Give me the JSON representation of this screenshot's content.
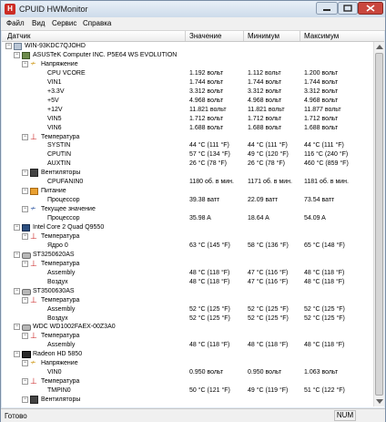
{
  "window": {
    "title": "CPUID HWMonitor",
    "app_icon_letter": "H"
  },
  "menu": {
    "items": [
      "Файл",
      "Вид",
      "Сервис",
      "Справка"
    ]
  },
  "columns": {
    "sensor": "Датчик",
    "value": "Значение",
    "min": "Минимум",
    "max": "Максимум"
  },
  "tree": [
    {
      "indent": 0,
      "expander": "-",
      "icon": "pc",
      "label": "WIN-93KDC7QJOHD",
      "v": "",
      "mn": "",
      "mx": ""
    },
    {
      "indent": 1,
      "expander": "-",
      "icon": "board",
      "label": "ASUSTeK Computer INC. P5E64 WS EVOLUTION",
      "v": "",
      "mn": "",
      "mx": ""
    },
    {
      "indent": 2,
      "expander": "-",
      "icon": "volt",
      "label": "Напряжение",
      "v": "",
      "mn": "",
      "mx": ""
    },
    {
      "indent": 4,
      "expander": "",
      "icon": "",
      "label": "CPU VCORE",
      "v": "1.192 вольт",
      "mn": "1.112 вольт",
      "mx": "1.200 вольт"
    },
    {
      "indent": 4,
      "expander": "",
      "icon": "",
      "label": "VIN1",
      "v": "1.744 вольт",
      "mn": "1.744 вольт",
      "mx": "1.744 вольт"
    },
    {
      "indent": 4,
      "expander": "",
      "icon": "",
      "label": "+3.3V",
      "v": "3.312 вольт",
      "mn": "3.312 вольт",
      "mx": "3.312 вольт"
    },
    {
      "indent": 4,
      "expander": "",
      "icon": "",
      "label": "+5V",
      "v": "4.968 вольт",
      "mn": "4.968 вольт",
      "mx": "4.968 вольт"
    },
    {
      "indent": 4,
      "expander": "",
      "icon": "",
      "label": "+12V",
      "v": "11.821 вольт",
      "mn": "11.821 вольт",
      "mx": "11.877 вольт"
    },
    {
      "indent": 4,
      "expander": "",
      "icon": "",
      "label": "VIN5",
      "v": "1.712 вольт",
      "mn": "1.712 вольт",
      "mx": "1.712 вольт"
    },
    {
      "indent": 4,
      "expander": "",
      "icon": "",
      "label": "VIN6",
      "v": "1.688 вольт",
      "mn": "1.688 вольт",
      "mx": "1.688 вольт"
    },
    {
      "indent": 2,
      "expander": "-",
      "icon": "therm",
      "label": "Температура",
      "v": "",
      "mn": "",
      "mx": ""
    },
    {
      "indent": 4,
      "expander": "",
      "icon": "",
      "label": "SYSTIN",
      "v": "44 °C (111 °F)",
      "mn": "44 °C (111 °F)",
      "mx": "44 °C (111 °F)"
    },
    {
      "indent": 4,
      "expander": "",
      "icon": "",
      "label": "CPUTIN",
      "v": "57 °C (134 °F)",
      "mn": "49 °C (120 °F)",
      "mx": "116 °C (240 °F)"
    },
    {
      "indent": 4,
      "expander": "",
      "icon": "",
      "label": "AUXTIN",
      "v": "26 °C (78 °F)",
      "mn": "26 °C (78 °F)",
      "mx": "460 °C (859 °F)"
    },
    {
      "indent": 2,
      "expander": "-",
      "icon": "fan",
      "label": "Вентиляторы",
      "v": "",
      "mn": "",
      "mx": ""
    },
    {
      "indent": 4,
      "expander": "",
      "icon": "",
      "label": "CPUFANIN0",
      "v": "1180 об. в мин.",
      "mn": "1171 об. в мин.",
      "mx": "1181 об. в мин."
    },
    {
      "indent": 2,
      "expander": "-",
      "icon": "power",
      "label": "Питание",
      "v": "",
      "mn": "",
      "mx": ""
    },
    {
      "indent": 4,
      "expander": "",
      "icon": "",
      "label": "Процессор",
      "v": "39.38 ватт",
      "mn": "22.09 ватт",
      "mx": "73.54 ватт"
    },
    {
      "indent": 2,
      "expander": "-",
      "icon": "curr",
      "label": "Текущее значение",
      "v": "",
      "mn": "",
      "mx": ""
    },
    {
      "indent": 4,
      "expander": "",
      "icon": "",
      "label": "Процессор",
      "v": "35.98 A",
      "mn": "18.64 A",
      "mx": "54.09 A"
    },
    {
      "indent": 1,
      "expander": "-",
      "icon": "cpu",
      "label": "Intel Core 2 Quad Q9550",
      "v": "",
      "mn": "",
      "mx": ""
    },
    {
      "indent": 2,
      "expander": "-",
      "icon": "therm",
      "label": "Температура",
      "v": "",
      "mn": "",
      "mx": ""
    },
    {
      "indent": 4,
      "expander": "",
      "icon": "",
      "label": "Ядро 0",
      "v": "63 °C (145 °F)",
      "mn": "58 °C (136 °F)",
      "mx": "65 °C (148 °F)"
    },
    {
      "indent": 1,
      "expander": "-",
      "icon": "disk",
      "label": "ST3250620AS",
      "v": "",
      "mn": "",
      "mx": ""
    },
    {
      "indent": 2,
      "expander": "-",
      "icon": "therm",
      "label": "Температура",
      "v": "",
      "mn": "",
      "mx": ""
    },
    {
      "indent": 4,
      "expander": "",
      "icon": "",
      "label": "Assembly",
      "v": "48 °C (118 °F)",
      "mn": "47 °C (116 °F)",
      "mx": "48 °C (118 °F)"
    },
    {
      "indent": 4,
      "expander": "",
      "icon": "",
      "label": "Воздух",
      "v": "48 °C (118 °F)",
      "mn": "47 °C (116 °F)",
      "mx": "48 °C (118 °F)"
    },
    {
      "indent": 1,
      "expander": "-",
      "icon": "disk",
      "label": "ST3500630AS",
      "v": "",
      "mn": "",
      "mx": ""
    },
    {
      "indent": 2,
      "expander": "-",
      "icon": "therm",
      "label": "Температура",
      "v": "",
      "mn": "",
      "mx": ""
    },
    {
      "indent": 4,
      "expander": "",
      "icon": "",
      "label": "Assembly",
      "v": "52 °C (125 °F)",
      "mn": "52 °C (125 °F)",
      "mx": "52 °C (125 °F)"
    },
    {
      "indent": 4,
      "expander": "",
      "icon": "",
      "label": "Воздух",
      "v": "52 °C (125 °F)",
      "mn": "52 °C (125 °F)",
      "mx": "52 °C (125 °F)"
    },
    {
      "indent": 1,
      "expander": "-",
      "icon": "disk",
      "label": "WDC WD1002FAEX-00Z3A0",
      "v": "",
      "mn": "",
      "mx": ""
    },
    {
      "indent": 2,
      "expander": "-",
      "icon": "therm",
      "label": "Температура",
      "v": "",
      "mn": "",
      "mx": ""
    },
    {
      "indent": 4,
      "expander": "",
      "icon": "",
      "label": "Assembly",
      "v": "48 °C (118 °F)",
      "mn": "48 °C (118 °F)",
      "mx": "48 °C (118 °F)"
    },
    {
      "indent": 1,
      "expander": "-",
      "icon": "gpu",
      "label": "Radeon HD 5850",
      "v": "",
      "mn": "",
      "mx": ""
    },
    {
      "indent": 2,
      "expander": "-",
      "icon": "volt",
      "label": "Напряжение",
      "v": "",
      "mn": "",
      "mx": ""
    },
    {
      "indent": 4,
      "expander": "",
      "icon": "",
      "label": "VIN0",
      "v": "0.950 вольт",
      "mn": "0.950 вольт",
      "mx": "1.063 вольт"
    },
    {
      "indent": 2,
      "expander": "-",
      "icon": "therm",
      "label": "Температура",
      "v": "",
      "mn": "",
      "mx": ""
    },
    {
      "indent": 4,
      "expander": "",
      "icon": "",
      "label": "TMPIN0",
      "v": "50 °C (121 °F)",
      "mn": "49 °C (119 °F)",
      "mx": "51 °C (122 °F)"
    },
    {
      "indent": 2,
      "expander": "-",
      "icon": "fan",
      "label": "Вентиляторы",
      "v": "",
      "mn": "",
      "mx": ""
    }
  ],
  "status": {
    "text": "Готово",
    "num": "NUM"
  }
}
